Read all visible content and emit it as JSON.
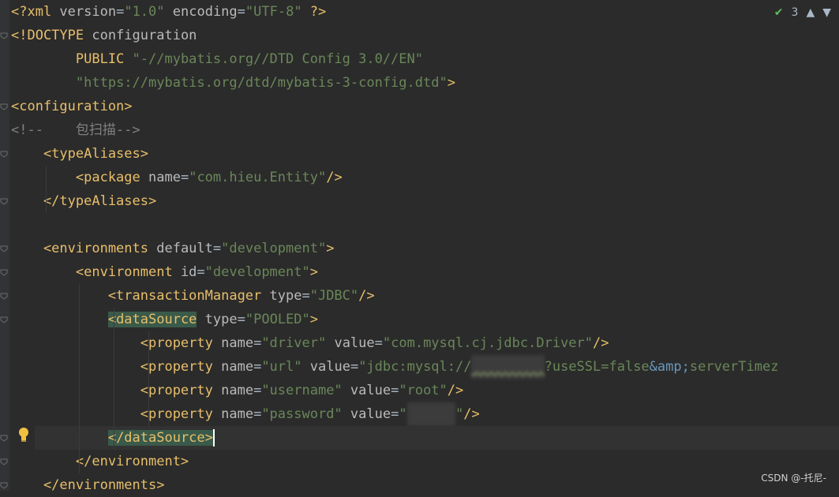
{
  "lines": [
    {
      "id": 1,
      "tokens": [
        {
          "t": "<?xml ",
          "c": "pi"
        },
        {
          "t": "version",
          "c": "attr"
        },
        {
          "t": "=",
          "c": ""
        },
        {
          "t": "\"1.0\"",
          "c": "str"
        },
        {
          "t": " ",
          "c": ""
        },
        {
          "t": "encoding",
          "c": "attr"
        },
        {
          "t": "=",
          "c": ""
        },
        {
          "t": "\"UTF-8\"",
          "c": "str"
        },
        {
          "t": " ?>",
          "c": "pi"
        }
      ]
    },
    {
      "id": 2,
      "tokens": [
        {
          "t": "<!DOCTYPE ",
          "c": "tag"
        },
        {
          "t": "configuration",
          "c": "attr"
        }
      ]
    },
    {
      "id": 3,
      "tokens": [
        {
          "t": "        PUBLIC ",
          "c": "tag"
        },
        {
          "t": "\"-//mybatis.org//DTD Config 3.0//EN\"",
          "c": "str"
        }
      ]
    },
    {
      "id": 4,
      "tokens": [
        {
          "t": "        ",
          "c": ""
        },
        {
          "t": "\"https://mybatis.org/dtd/mybatis-3-config.dtd\"",
          "c": "str"
        },
        {
          "t": ">",
          "c": "tag"
        }
      ]
    },
    {
      "id": 5,
      "tokens": [
        {
          "t": "<configuration>",
          "c": "tag"
        }
      ]
    },
    {
      "id": 6,
      "tokens": [
        {
          "t": "<!--    包扫描-->",
          "c": "cmt"
        }
      ]
    },
    {
      "id": 7,
      "tokens": [
        {
          "t": "    <typeAliases>",
          "c": "tag"
        }
      ]
    },
    {
      "id": 8,
      "tokens": [
        {
          "t": "        <package ",
          "c": "tag"
        },
        {
          "t": "name",
          "c": "attr"
        },
        {
          "t": "=",
          "c": ""
        },
        {
          "t": "\"com.hieu.Entity\"",
          "c": "str"
        },
        {
          "t": "/>",
          "c": "tag"
        }
      ]
    },
    {
      "id": 9,
      "tokens": [
        {
          "t": "    </typeAliases>",
          "c": "tag"
        }
      ]
    },
    {
      "id": 10,
      "tokens": []
    },
    {
      "id": 11,
      "tokens": [
        {
          "t": "    <environments ",
          "c": "tag"
        },
        {
          "t": "default",
          "c": "attr"
        },
        {
          "t": "=",
          "c": ""
        },
        {
          "t": "\"development\"",
          "c": "str"
        },
        {
          "t": ">",
          "c": "tag"
        }
      ]
    },
    {
      "id": 12,
      "tokens": [
        {
          "t": "        <environment ",
          "c": "tag"
        },
        {
          "t": "id",
          "c": "attr"
        },
        {
          "t": "=",
          "c": ""
        },
        {
          "t": "\"development\"",
          "c": "str"
        },
        {
          "t": ">",
          "c": "tag"
        }
      ]
    },
    {
      "id": 13,
      "tokens": [
        {
          "t": "            <transactionManager ",
          "c": "tag"
        },
        {
          "t": "type",
          "c": "attr"
        },
        {
          "t": "=",
          "c": ""
        },
        {
          "t": "\"JDBC\"",
          "c": "str"
        },
        {
          "t": "/>",
          "c": "tag"
        }
      ]
    },
    {
      "id": 14,
      "tokens": [
        {
          "t": "            ",
          "c": ""
        },
        {
          "t": "<dataSource",
          "c": "tag hl"
        },
        {
          "t": " ",
          "c": ""
        },
        {
          "t": "type",
          "c": "attr"
        },
        {
          "t": "=",
          "c": ""
        },
        {
          "t": "\"POOLED\"",
          "c": "str"
        },
        {
          "t": ">",
          "c": "tag"
        }
      ]
    },
    {
      "id": 15,
      "tokens": [
        {
          "t": "                <property ",
          "c": "tag"
        },
        {
          "t": "name",
          "c": "attr"
        },
        {
          "t": "=",
          "c": ""
        },
        {
          "t": "\"driver\"",
          "c": "str"
        },
        {
          "t": " ",
          "c": ""
        },
        {
          "t": "value",
          "c": "attr"
        },
        {
          "t": "=",
          "c": ""
        },
        {
          "t": "\"com.mysql.cj.jdbc.Driver\"",
          "c": "str"
        },
        {
          "t": "/>",
          "c": "tag"
        }
      ]
    },
    {
      "id": 16,
      "tokens": [
        {
          "t": "                <property ",
          "c": "tag"
        },
        {
          "t": "name",
          "c": "attr"
        },
        {
          "t": "=",
          "c": ""
        },
        {
          "t": "\"url\"",
          "c": "str"
        },
        {
          "t": " ",
          "c": ""
        },
        {
          "t": "value",
          "c": "attr"
        },
        {
          "t": "=",
          "c": ""
        },
        {
          "t": "\"jdbc:mysql://",
          "c": "str"
        },
        {
          "t": "xxxxxxxxx",
          "c": "str blur squig"
        },
        {
          "t": "?useSSL=false",
          "c": "str"
        },
        {
          "t": "&amp;",
          "c": "ent"
        },
        {
          "t": "serverTimez",
          "c": "str"
        }
      ]
    },
    {
      "id": 17,
      "tokens": [
        {
          "t": "                <property ",
          "c": "tag"
        },
        {
          "t": "name",
          "c": "attr"
        },
        {
          "t": "=",
          "c": ""
        },
        {
          "t": "\"username\"",
          "c": "str"
        },
        {
          "t": " ",
          "c": ""
        },
        {
          "t": "value",
          "c": "attr"
        },
        {
          "t": "=",
          "c": ""
        },
        {
          "t": "\"root\"",
          "c": "str"
        },
        {
          "t": "/>",
          "c": "tag"
        }
      ]
    },
    {
      "id": 18,
      "tokens": [
        {
          "t": "                <property ",
          "c": "tag"
        },
        {
          "t": "name",
          "c": "attr"
        },
        {
          "t": "=",
          "c": ""
        },
        {
          "t": "\"password\"",
          "c": "str"
        },
        {
          "t": " ",
          "c": ""
        },
        {
          "t": "value",
          "c": "attr"
        },
        {
          "t": "=",
          "c": ""
        },
        {
          "t": "\"",
          "c": "str"
        },
        {
          "t": "xxxxxx",
          "c": "str blur"
        },
        {
          "t": "\"",
          "c": "str"
        },
        {
          "t": "/>",
          "c": "tag"
        }
      ]
    },
    {
      "id": 19,
      "tokens": [
        {
          "t": "            ",
          "c": ""
        },
        {
          "t": "</dataSource>",
          "c": "tag hl"
        }
      ],
      "caret": true
    },
    {
      "id": 20,
      "tokens": [
        {
          "t": "        </environment>",
          "c": "tag"
        }
      ]
    },
    {
      "id": 21,
      "tokens": [
        {
          "t": "    </environments>",
          "c": "tag"
        }
      ]
    }
  ],
  "inspection": {
    "count": "3",
    "check_icon": "check-icon",
    "up_icon": "chevron-up-icon",
    "down_icon": "chevron-down-icon"
  },
  "watermark": "CSDN @-托尼-",
  "colors": {
    "background": "#2b2b2b",
    "tag": "#e8bf6a",
    "string": "#6a8759",
    "attribute": "#bababa",
    "comment": "#808080",
    "entity": "#6897bb"
  }
}
